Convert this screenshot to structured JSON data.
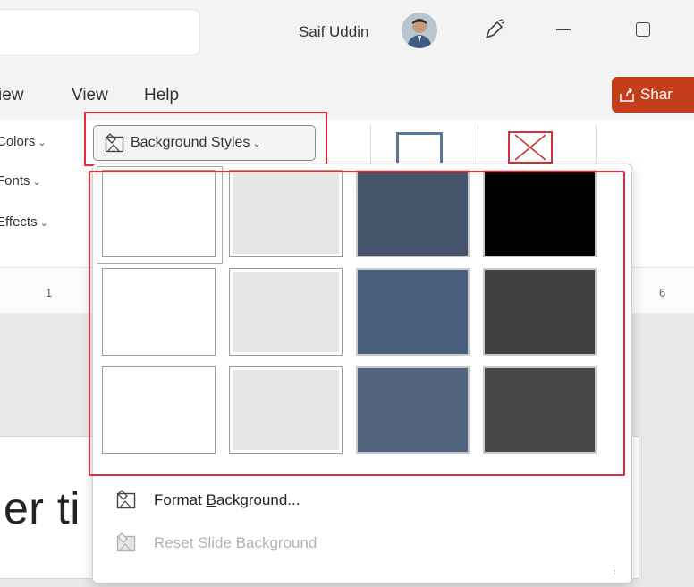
{
  "titlebar": {
    "user_name": "Saif Uddin"
  },
  "menubar": {
    "items": [
      "iew",
      "View",
      "Help"
    ],
    "share_label": "Shar"
  },
  "ribbon": {
    "colors_label": "Colors",
    "fonts_label": "Fonts",
    "effects_label": "Effects",
    "background_styles_label": "Background Styles"
  },
  "ruler": {
    "left_number": "1",
    "right_number": "6"
  },
  "slide": {
    "visible_title_fragment": "er ti"
  },
  "background_styles_gallery": {
    "swatches": [
      {
        "style": "style-1",
        "color": "#ffffff",
        "selected": true
      },
      {
        "style": "style-2",
        "color": "#e7e5e6",
        "selected": false
      },
      {
        "style": "style-3",
        "color": "#44546a",
        "selected": false
      },
      {
        "style": "style-4",
        "color": "#000000",
        "selected": false
      },
      {
        "style": "style-5",
        "color": "#ffffff",
        "selected": false
      },
      {
        "style": "style-6",
        "color": "#e7e5e6",
        "selected": false
      },
      {
        "style": "style-7",
        "color": "#4a5f7e",
        "selected": false
      },
      {
        "style": "style-8",
        "color": "#404040",
        "selected": false
      },
      {
        "style": "style-9",
        "color": "#ffffff",
        "selected": false
      },
      {
        "style": "style-10",
        "color": "#e7e5e6",
        "selected": false
      },
      {
        "style": "style-11",
        "color": "#52637d",
        "selected": false
      },
      {
        "style": "style-12",
        "color": "#484848",
        "selected": false
      }
    ]
  },
  "dropdown_menu": {
    "format_background": {
      "before": "Format ",
      "accel": "B",
      "after": "ackground..."
    },
    "reset_slide_background": {
      "before": "",
      "accel": "R",
      "after": "eset Slide Background"
    }
  },
  "colors": {
    "accent_red": "#c43e1c",
    "highlight_red": "#e22e3a"
  },
  "icons": {
    "pen": "pen-icon",
    "minimize": "minimize-icon",
    "maximize": "maximize-icon",
    "share": "share-icon",
    "background_styles": "background-styles-icon",
    "format_background": "format-background-icon",
    "reset_background": "reset-background-icon"
  }
}
